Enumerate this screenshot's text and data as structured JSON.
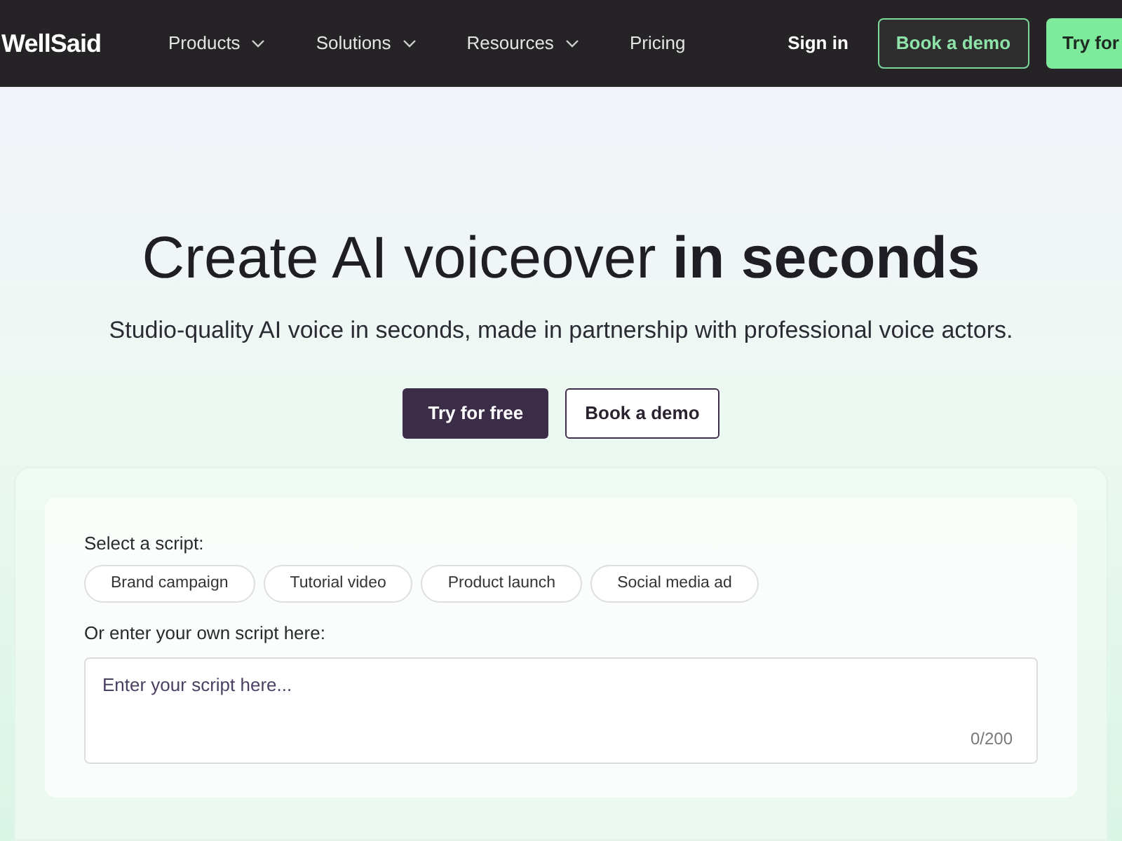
{
  "header": {
    "logo": "WellSaid",
    "nav": [
      {
        "label": "Products",
        "has_menu": true
      },
      {
        "label": "Solutions",
        "has_menu": true
      },
      {
        "label": "Resources",
        "has_menu": true
      },
      {
        "label": "Pricing",
        "has_menu": false
      }
    ],
    "sign_in": "Sign in",
    "book_demo": "Book a demo",
    "try_free": "Try for"
  },
  "hero": {
    "title": "Create AI voiceover **in seconds**",
    "subtitle": "Studio-quality AI voice in seconds, made in partnership with professional voice actors.",
    "primary_button": "Try for free",
    "secondary_button": "Book a demo"
  },
  "demo": {
    "select_label": "Select a script:",
    "scripts": [
      "Brand campaign",
      "Tutorial video",
      "Product launch",
      "Social media ad"
    ],
    "input_label": "Or enter your own script here:",
    "placeholder": "Enter your script here...",
    "counter": "0/200"
  }
}
